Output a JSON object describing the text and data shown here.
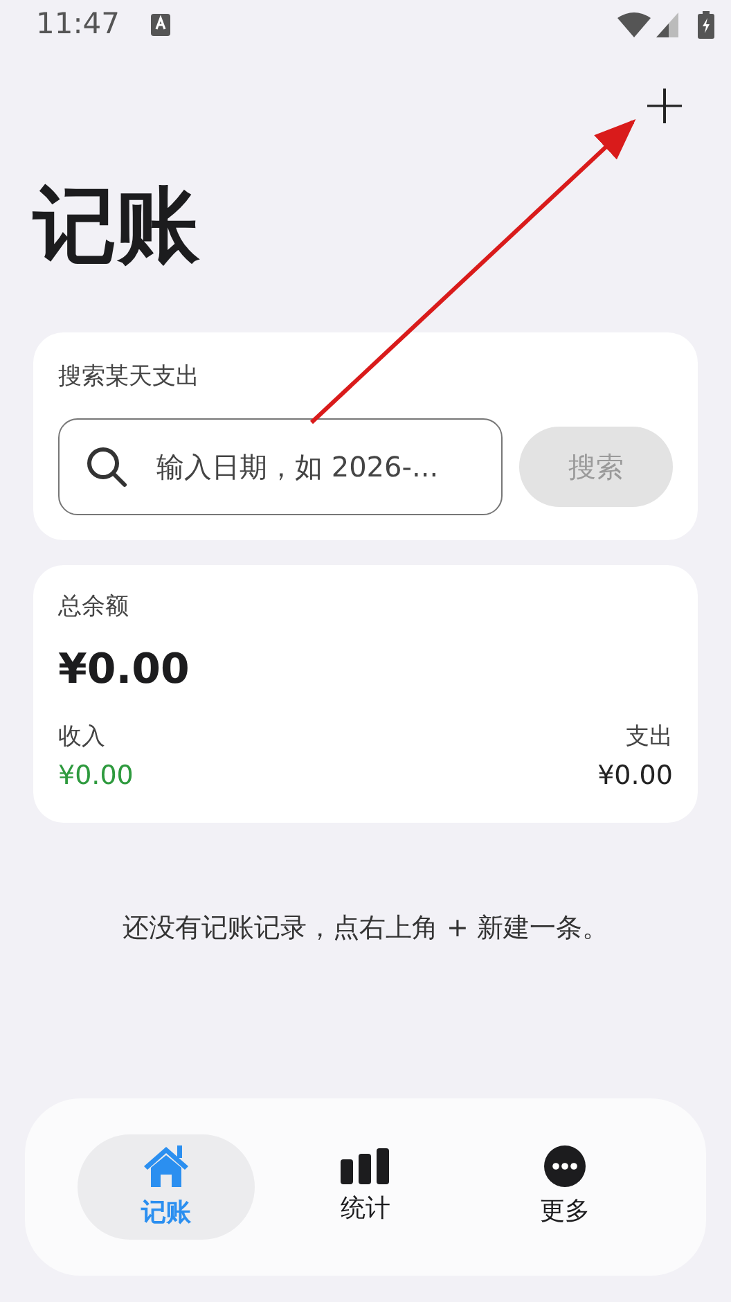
{
  "status_bar": {
    "time": "11:47"
  },
  "header": {
    "add_button": "+",
    "title": "记账"
  },
  "search_card": {
    "label": "搜索某天支出",
    "placeholder": "输入日期，如 2026-...",
    "button": {
      "label": "搜索",
      "disabled": true
    }
  },
  "balance_card": {
    "label": "总余额",
    "total": "¥0.00",
    "income_label": "收入",
    "income": "¥0.00",
    "expense_label": "支出",
    "expense": "¥0.00"
  },
  "empty_message": "还没有记账记录，点右上角 + 新建一条。",
  "tabs": [
    {
      "kind": "home",
      "label": "记账",
      "selected": true
    },
    {
      "kind": "stats",
      "label": "统计",
      "selected": false
    },
    {
      "kind": "more",
      "label": "更多",
      "selected": false
    }
  ]
}
